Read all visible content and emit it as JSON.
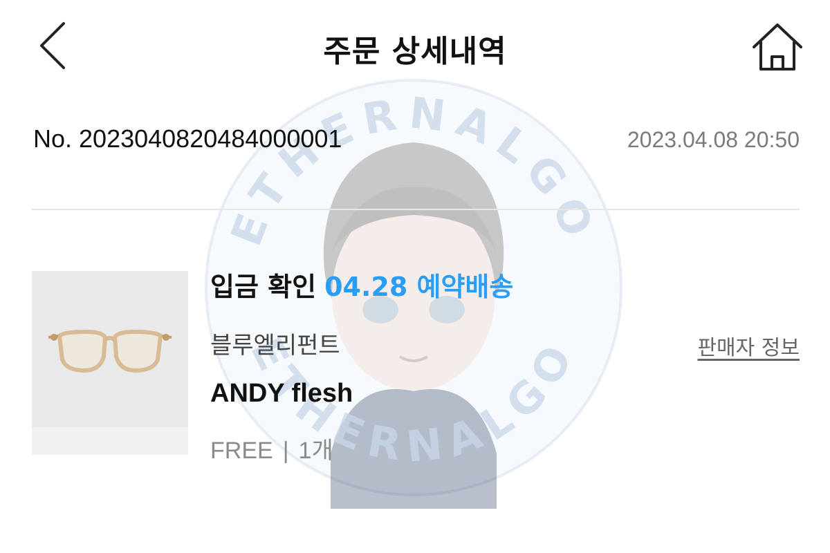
{
  "header": {
    "title": "주문 상세내역",
    "back_icon": "chevron-left-icon",
    "home_icon": "home-icon"
  },
  "order": {
    "number": "No. 2023040820484000001",
    "datetime": "2023.04.08 20:50"
  },
  "item": {
    "status": "입금 확인",
    "delivery": "04.28 예약배송",
    "brand": "블루엘리펀트",
    "name": "ANDY flesh",
    "option": "FREE",
    "separator": "|",
    "quantity": "1개",
    "seller_info_link": "판매자 정보",
    "image": "eyeglasses-product-image"
  },
  "watermark": {
    "text": "ETHERNALGO"
  },
  "colors": {
    "accent": "#2a9df4",
    "muted": "#7b7b7b",
    "divider": "#e6e6e6"
  }
}
